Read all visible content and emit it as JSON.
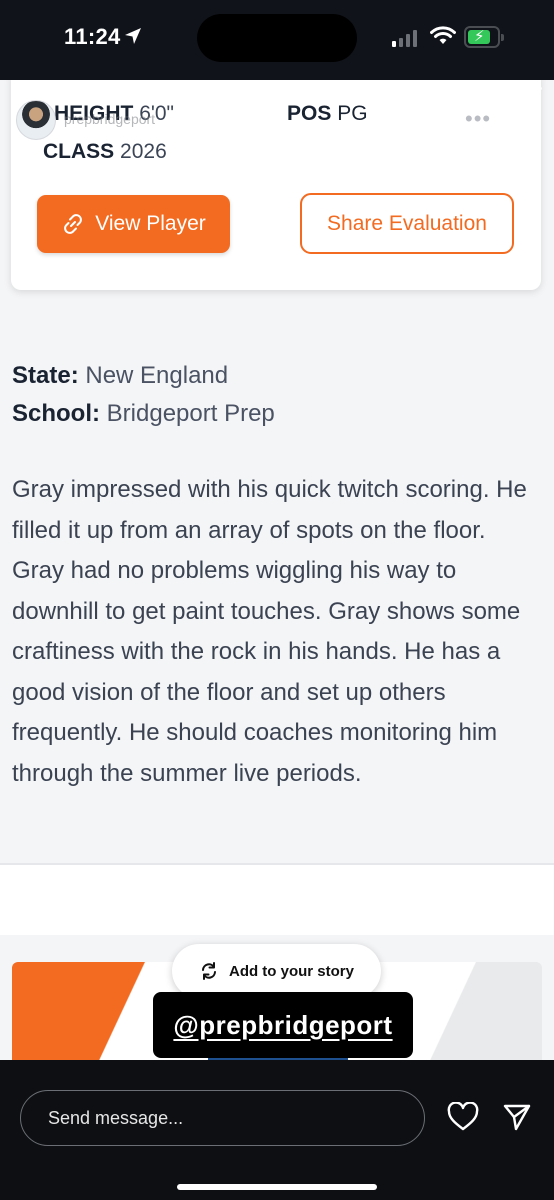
{
  "status_bar": {
    "time": "11:24",
    "location_icon": "location-arrow-icon",
    "signal_bars_on": 1,
    "battery_level": 0.6,
    "battery_color": "#34c759"
  },
  "story": {
    "user": {
      "name": "prepbridgeport",
      "avatar": "avatar"
    },
    "card": {
      "height_label": "HEIGHT",
      "height_value": "6'0\"",
      "pos_label": "POS",
      "pos_value": "PG",
      "class_label": "CLASS",
      "class_value": "2026",
      "view_player_label": "View Player",
      "share_evaluation_label": "Share Evaluation"
    },
    "details": {
      "state_label": "State:",
      "state_value": "New England",
      "school_label": "School:",
      "school_value": "Bridgeport Prep"
    },
    "evaluation": "Gray impressed with his quick twitch scoring. He filled it up from an array of spots on the floor. Gray had no problems wiggling his way to downhill to get paint touches. Gray shows some craftiness with the rock in his hands. He has a good vision of the floor and set up others frequently. He should coaches monitoring him through the summer live periods.",
    "add_to_story_label": "Add to your story",
    "mention_sticker": "@prepbridgeport",
    "accent_color": "#f26b21"
  },
  "bottom_bar": {
    "message_placeholder": "Send message..."
  }
}
